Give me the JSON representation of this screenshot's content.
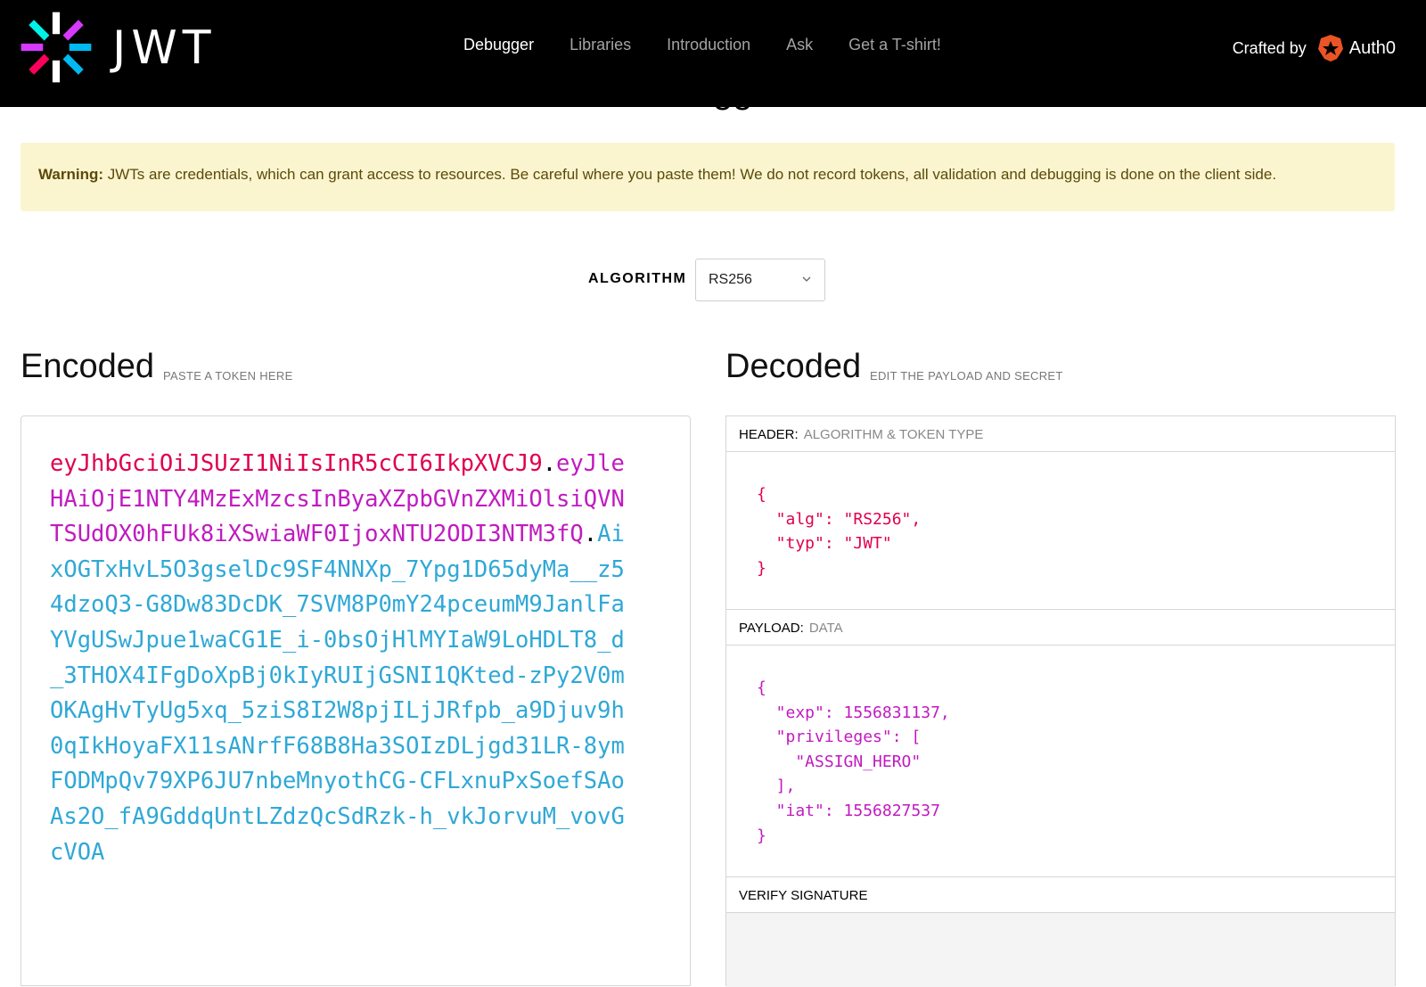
{
  "nav": {
    "logo_text": "JWT",
    "links": [
      "Debugger",
      "Libraries",
      "Introduction",
      "Ask",
      "Get a T-shirt!"
    ],
    "active": "Debugger",
    "crafted_by": "Crafted by",
    "auth0": "Auth0"
  },
  "page_title_fragment": "gg",
  "warning": {
    "label": "Warning:",
    "text": " JWTs are credentials, which can grant access to resources. Be careful where you paste them! We do not record tokens, all validation and debugging is done on the client side."
  },
  "algorithm": {
    "label": "ALGORITHM",
    "selected": "RS256"
  },
  "encoded": {
    "title": "Encoded",
    "subtitle": "PASTE A TOKEN HERE",
    "header_part": "eyJhbGciOiJSUzI1NiIsInR5cCI6IkpXVCJ9",
    "payload_part": "eyJleHAiOjE1NTY4MzExMzcsInByaXZpbGVnZXMiOlsiQVNTSUdOX0hFUk8iXSwiaWF0IjoxNTU2ODI3NTM3fQ",
    "signature_part": "AixOGTxHvL5O3gselDc9SF4NNXp_7Ypg1D65dyMa__z54dzoQ3-G8Dw83DcDK_7SVM8P0mY24pceumM9JanlFaYVgUSwJpue1waCG1E_i-0bsOjHlMYIaW9LoHDLT8_d_3THOX4IFgDoXpBj0kIyRUIjGSNI1QKted-zPy2V0mOKAgHvTyUg5xq_5ziS8I2W8pjILjJRfpb_a9Djuv9h0qIkHoyaFX11sANrfF68B8Ha3SOIzDLjgd31LR-8ymFODMpQv79XP6JU7nbeMnyothCG-CFLxnuPxSoefSAoAs2O_fA9GddqUntLZdzQcSdRzk-h_vkJorvuM_vovGcVOA",
    "dot": "."
  },
  "decoded": {
    "title": "Decoded",
    "subtitle": "EDIT THE PAYLOAD AND SECRET",
    "header_label": "HEADER:",
    "header_sub": "ALGORITHM & TOKEN TYPE",
    "header_json": "{\n  \"alg\": \"RS256\",\n  \"typ\": \"JWT\"\n}",
    "payload_label": "PAYLOAD:",
    "payload_sub": "DATA",
    "payload_json": "{\n  \"exp\": 1556831137,\n  \"privileges\": [\n    \"ASSIGN_HERO\"\n  ],\n  \"iat\": 1556827537\n}",
    "verify_label": "VERIFY SIGNATURE"
  },
  "colors": {
    "header": "#e0004f",
    "payload": "#c01bc0",
    "signature": "#2fa8d6",
    "warning_bg": "#fbf5cf"
  }
}
